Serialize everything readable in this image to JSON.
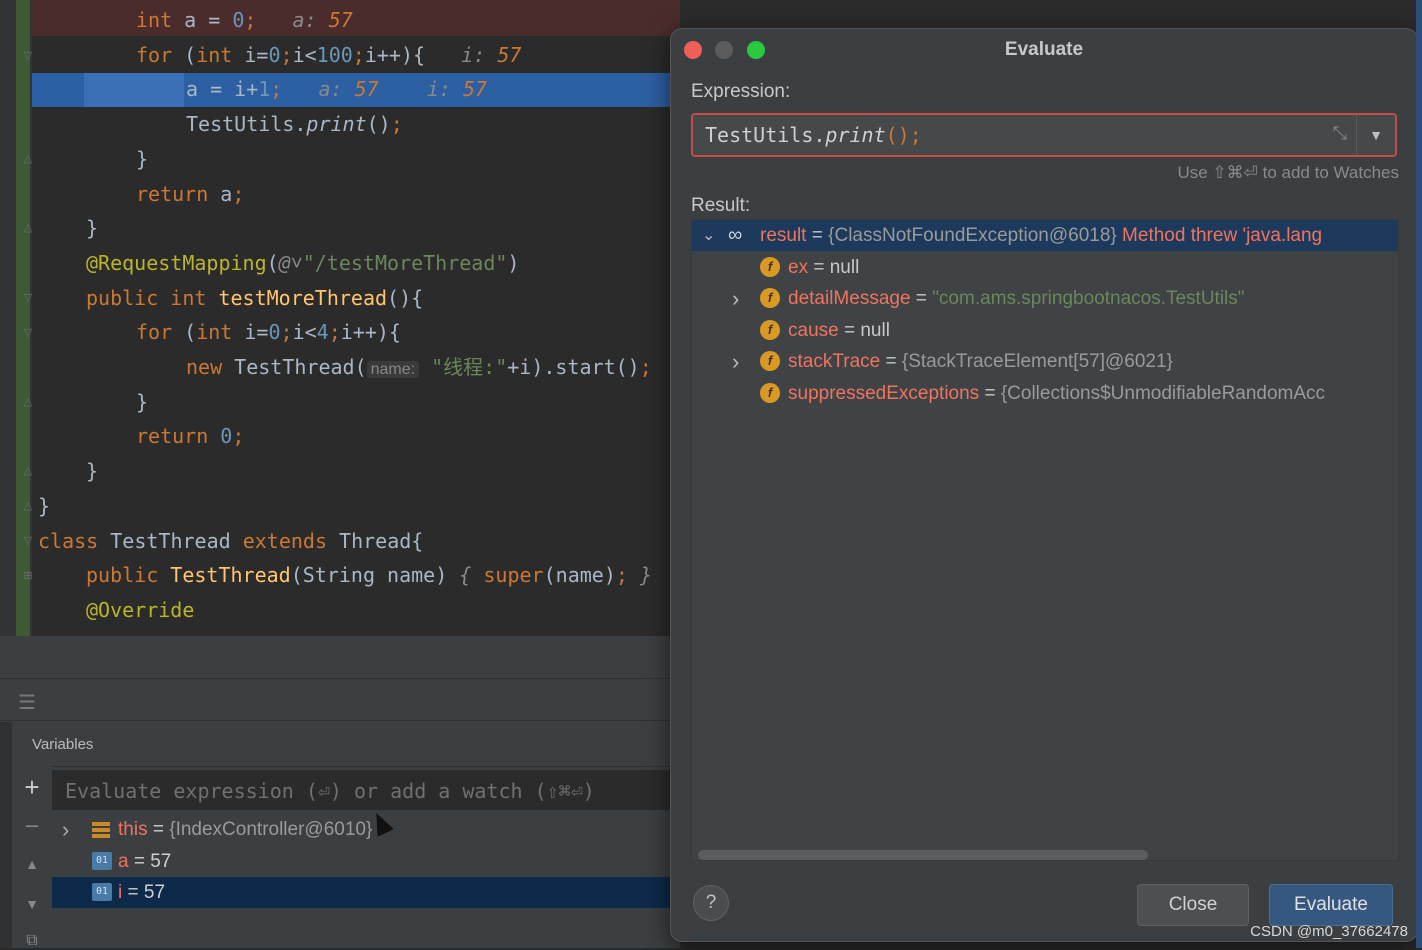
{
  "editor": {
    "lines": [
      {
        "parts": [
          [
            "k",
            "int "
          ],
          [
            "",
            "a"
          ],
          [
            "",
            " = "
          ],
          [
            "n",
            "0"
          ],
          [
            "k",
            ";"
          ],
          [
            "hint",
            "   a: "
          ],
          [
            "hintv",
            "57"
          ]
        ]
      },
      {
        "parts": [
          [
            "k",
            "for "
          ],
          [
            "",
            "("
          ],
          [
            "k",
            "int "
          ],
          [
            "",
            "i="
          ],
          [
            "n",
            "0"
          ],
          [
            "k",
            ";"
          ],
          [
            "",
            "i<"
          ],
          [
            "n",
            "100"
          ],
          [
            "k",
            ";"
          ],
          [
            "",
            "i++){"
          ],
          [
            "hint",
            "   i: "
          ],
          [
            "hintv",
            "57"
          ]
        ]
      },
      {
        "parts": [
          [
            "",
            "a = i+"
          ],
          [
            "n",
            "1"
          ],
          [
            "k",
            ";"
          ],
          [
            "hint",
            "   a: "
          ],
          [
            "hintv",
            "57"
          ],
          [
            "hint",
            "    i: "
          ],
          [
            "hintv",
            "57"
          ]
        ]
      },
      {
        "parts": [
          [
            "",
            "TestUtils."
          ],
          [
            "it",
            "print"
          ],
          [
            "",
            "()"
          ],
          [
            "k",
            ";"
          ]
        ]
      },
      {
        "parts": [
          [
            "",
            "}"
          ]
        ]
      },
      {
        "parts": [
          [
            "k",
            "return "
          ],
          [
            "",
            "a"
          ],
          [
            "k",
            ";"
          ]
        ]
      },
      {
        "parts": [
          [
            "",
            "}"
          ]
        ]
      },
      {
        "parts": [
          [
            "an",
            "@RequestMapping"
          ],
          [
            "",
            "("
          ],
          [
            "hint",
            "@˅"
          ],
          [
            "s",
            "\"/testMoreThread\""
          ],
          [
            "",
            ")"
          ]
        ]
      },
      {
        "parts": [
          [
            "k",
            "public int "
          ],
          [
            "fn",
            "testMoreThread"
          ],
          [
            "",
            "(){"
          ]
        ]
      },
      {
        "parts": [
          [
            "k",
            "for "
          ],
          [
            "",
            "("
          ],
          [
            "k",
            "int "
          ],
          [
            "",
            "i="
          ],
          [
            "n",
            "0"
          ],
          [
            "k",
            ";"
          ],
          [
            "",
            "i<"
          ],
          [
            "n",
            "4"
          ],
          [
            "k",
            ";"
          ],
          [
            "",
            "i++){"
          ]
        ]
      },
      {
        "parts": [
          [
            "k",
            "new "
          ],
          [
            "",
            "TestThread("
          ],
          [
            "ph",
            "name:"
          ],
          [
            "s",
            " \"线程:\""
          ],
          [
            "",
            "+i).start()"
          ],
          [
            "k",
            ";"
          ]
        ]
      },
      {
        "parts": [
          [
            "",
            "}"
          ]
        ]
      },
      {
        "parts": [
          [
            "k",
            "return "
          ],
          [
            "n",
            "0"
          ],
          [
            "k",
            ";"
          ]
        ]
      },
      {
        "parts": [
          [
            "",
            "}"
          ]
        ]
      },
      {
        "parts": [
          [
            "",
            "}"
          ]
        ]
      },
      {
        "parts": [
          [
            "k",
            "class "
          ],
          [
            "",
            "TestThread "
          ],
          [
            "k",
            "extends "
          ],
          [
            "",
            "Thread{"
          ]
        ]
      },
      {
        "parts": [
          [
            "k",
            "public "
          ],
          [
            "fn",
            "TestThread"
          ],
          [
            "",
            "(String name) "
          ],
          [
            "hint",
            "{ "
          ],
          [
            "k",
            "super"
          ],
          [
            "",
            "(name)"
          ],
          [
            "k",
            ";"
          ],
          [
            "hint",
            " }"
          ]
        ]
      },
      {
        "parts": [
          [
            "an",
            "@Override"
          ]
        ]
      }
    ]
  },
  "debug": {
    "variables_tab": "Variables",
    "watch_placeholder": "Evaluate expression (⏎) or add a watch (⇧⌘⏎)",
    "vars": [
      {
        "name": "this",
        "eq": " = ",
        "value": "{IndexController@6010}",
        "expandable": true,
        "icon": "object-icon"
      },
      {
        "name": "a",
        "eq": " = ",
        "value": "57",
        "expandable": false,
        "icon": "primitive-icon"
      },
      {
        "name": "i",
        "eq": " = ",
        "value": "57",
        "expandable": false,
        "icon": "primitive-icon",
        "selected": true
      }
    ]
  },
  "dialog": {
    "title": "Evaluate",
    "expression_label": "Expression:",
    "expression_prefix": "TestUtils.",
    "expression_method": "print",
    "expression_suffix": "();",
    "watch_hint": "Use ⇧⌘⏎ to add to Watches",
    "result_label": "Result:",
    "result": {
      "name": "result",
      "value": "{ClassNotFoundException@6018}",
      "error": "Method threw 'java.lang"
    },
    "fields": [
      {
        "name": "ex",
        "value": "null",
        "type": "null",
        "expandable": false
      },
      {
        "name": "detailMessage",
        "value": "\"com.ams.springbootnacos.TestUtils\"",
        "type": "string",
        "expandable": true
      },
      {
        "name": "cause",
        "value": "null",
        "type": "null",
        "expandable": false
      },
      {
        "name": "stackTrace",
        "value": "{StackTraceElement[57]@6021}",
        "type": "object",
        "expandable": true
      },
      {
        "name": "suppressedExceptions",
        "value": "{Collections$UnmodifiableRandomAcc",
        "type": "object",
        "expandable": false
      }
    ],
    "help_label": "?",
    "close_label": "Close",
    "evaluate_label": "Evaluate"
  },
  "watermark": "CSDN @m0_37662478",
  "colors": {
    "accent": "#365880",
    "error_border": "#c84b46",
    "field_name": "#f0735f"
  }
}
